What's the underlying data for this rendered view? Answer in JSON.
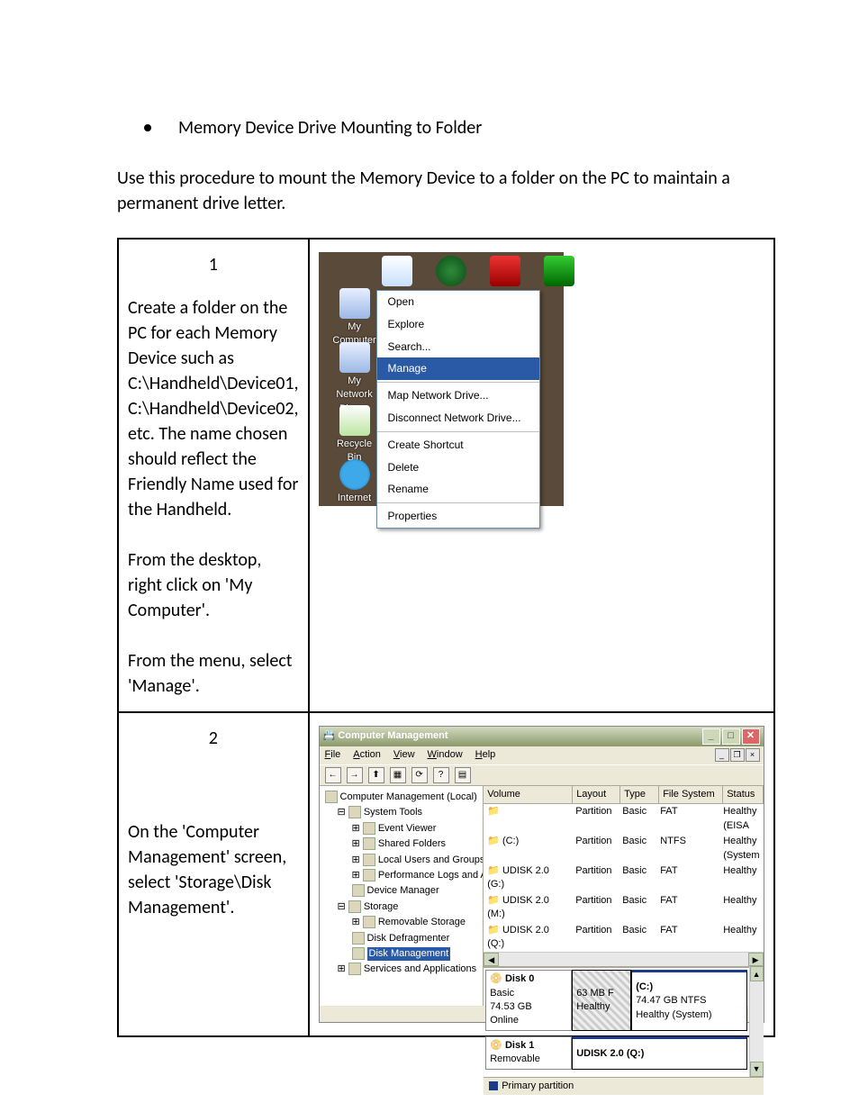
{
  "bullet": "Memory Device Drive Mounting to Folder",
  "intro": "Use this procedure to mount the Memory Device to a folder on the PC to maintain a permanent drive letter.",
  "step1": {
    "num": "1",
    "text": "Create a folder on the PC for each Memory Device such as C:\\Handheld\\Device01, C:\\Handheld\\Device02, etc. The name chosen should reflect the Friendly Name used for the Handheld.\n\nFrom the desktop, right click on 'My Computer'.\n\nFrom the menu, select 'Manage'."
  },
  "desktop_icons": {
    "my_computer": "My Computer",
    "my_network": "My Network Places",
    "recycle": "Recycle Bin",
    "ie": "Internet"
  },
  "context_menu": {
    "open": "Open",
    "explore": "Explore",
    "search": "Search...",
    "manage": "Manage",
    "map": "Map Network Drive...",
    "disconnect": "Disconnect Network Drive...",
    "create_shortcut": "Create Shortcut",
    "delete": "Delete",
    "rename": "Rename",
    "properties": "Properties"
  },
  "step2": {
    "num": "2",
    "text": "On the 'Computer Management' screen, select 'Storage\\Disk Management'."
  },
  "cm": {
    "title": "Computer Management",
    "menu": {
      "file": "File",
      "action": "Action",
      "view": "View",
      "window": "Window",
      "help": "Help"
    },
    "tree": {
      "root": "Computer Management (Local)",
      "system_tools": "System Tools",
      "event_viewer": "Event Viewer",
      "shared_folders": "Shared Folders",
      "local_users": "Local Users and Groups",
      "perf": "Performance Logs and Alerts",
      "devmgr": "Device Manager",
      "storage": "Storage",
      "removable": "Removable Storage",
      "defrag": "Disk Defragmenter",
      "diskmgmt": "Disk Management",
      "services": "Services and Applications"
    },
    "vol_headers": {
      "volume": "Volume",
      "layout": "Layout",
      "type": "Type",
      "fs": "File System",
      "status": "Status"
    },
    "volumes": [
      {
        "v": "",
        "l": "Partition",
        "t": "Basic",
        "fs": "FAT",
        "s": "Healthy (EISA"
      },
      {
        "v": "(C:)",
        "l": "Partition",
        "t": "Basic",
        "fs": "NTFS",
        "s": "Healthy (System"
      },
      {
        "v": "UDISK 2.0 (G:)",
        "l": "Partition",
        "t": "Basic",
        "fs": "FAT",
        "s": "Healthy"
      },
      {
        "v": "UDISK 2.0 (M:)",
        "l": "Partition",
        "t": "Basic",
        "fs": "FAT",
        "s": "Healthy"
      },
      {
        "v": "UDISK 2.0 (Q:)",
        "l": "Partition",
        "t": "Basic",
        "fs": "FAT",
        "s": "Healthy"
      }
    ],
    "disk0": {
      "name": "Disk 0",
      "type": "Basic",
      "size": "74.53 GB",
      "status": "Online",
      "seg1a": "63 MB F",
      "seg1b": "Healthy",
      "seg2a": "(C:)",
      "seg2b": "74.47 GB NTFS",
      "seg2c": "Healthy (System)"
    },
    "disk1": {
      "name": "Disk 1",
      "type": "Removable",
      "size": "",
      "seg": "UDISK 2.0  (Q:)"
    },
    "legend": "Primary partition"
  }
}
